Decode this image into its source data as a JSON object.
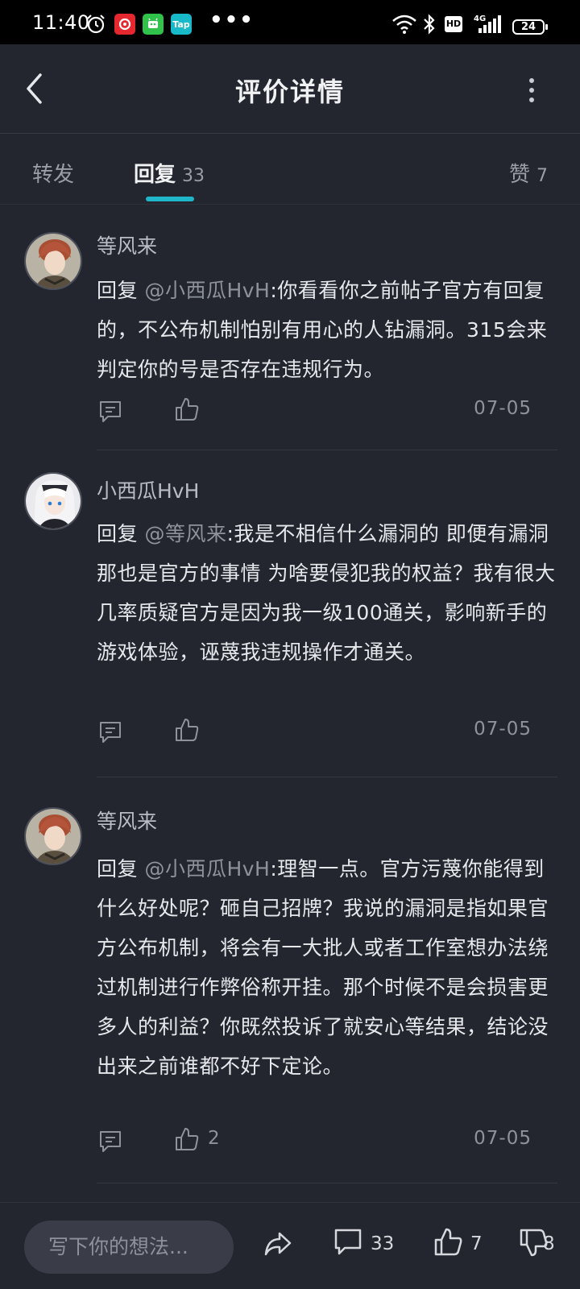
{
  "status_bar": {
    "time": "11:40",
    "app_badge_tap": "Tap",
    "dots": "•••",
    "hd": "HD",
    "network": "4G",
    "battery": "24"
  },
  "header": {
    "title": "评价详情",
    "back_icon": "chevron-left-icon",
    "more_icon": "more-vertical-icon"
  },
  "tabs": {
    "forward": "转发",
    "reply": "回复",
    "reply_count": "33",
    "like": "赞",
    "like_count": "7"
  },
  "comments": [
    {
      "author": "等风来",
      "reply_prefix": " 回复 ",
      "mention": "@小西瓜HvH",
      "text": ":你看看你之前帖子官方有回复的，不公布机制怕别有用心的人钻漏洞。315会来判定你的号是否存在违规行为。",
      "likes": "",
      "date": "07-05"
    },
    {
      "author": "小西瓜HvH",
      "reply_prefix": " 回复 ",
      "mention": "@等风来",
      "text": ":我是不相信什么漏洞的 即便有漏洞那也是官方的事情 为啥要侵犯我的权益？我有很大几率质疑官方是因为我一级100通关，影响新手的游戏体验，诬蔑我违规操作才通关。",
      "likes": "",
      "date": "07-05"
    },
    {
      "author": "等风来",
      "reply_prefix": " 回复 ",
      "mention": "@小西瓜HvH",
      "text": ":理智一点。官方污蔑你能得到什么好处呢？砸自己招牌？我说的漏洞是指如果官方公布机制，将会有一大批人或者工作室想办法绕过机制进行作弊俗称开挂。那个时候不是会损害更多人的利益？你既然投诉了就安心等结果，结论没出来之前谁都不好下定论。",
      "likes": "2",
      "date": "07-05"
    }
  ],
  "bottom_bar": {
    "input_placeholder": "写下你的想法...",
    "comment_count": "33",
    "like_count": "7",
    "dislike_count": "8"
  },
  "colors": {
    "background": "#23262f",
    "accent": "#1fb6c9",
    "muted_text": "#8e929b"
  }
}
